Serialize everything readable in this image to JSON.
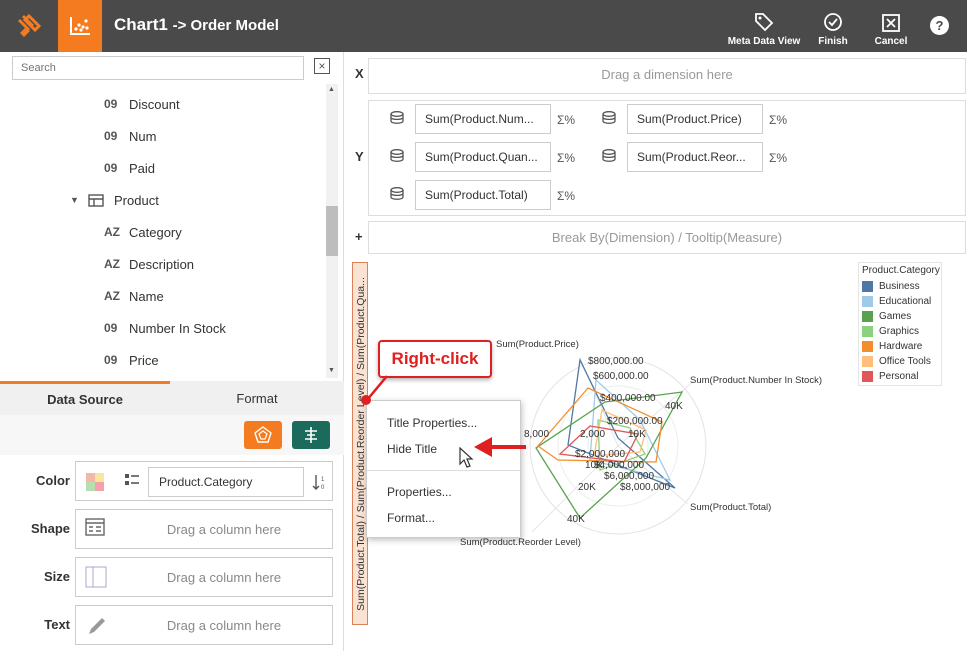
{
  "header": {
    "chart_name": "Chart1",
    "model_name": "-> Order Model",
    "buttons": [
      {
        "label": "Meta Data View",
        "icon": "tag-icon"
      },
      {
        "label": "Finish",
        "icon": "check-circle-icon"
      },
      {
        "label": "Cancel",
        "icon": "close-box-icon"
      }
    ],
    "help_icon": "help-icon"
  },
  "sidebar": {
    "search_placeholder": "Search",
    "tree": [
      {
        "type": "09",
        "label": "Discount"
      },
      {
        "type": "09",
        "label": "Num"
      },
      {
        "type": "09",
        "label": "Paid"
      },
      {
        "type": "table",
        "label": "Product"
      },
      {
        "type": "AZ",
        "label": "Category"
      },
      {
        "type": "AZ",
        "label": "Description"
      },
      {
        "type": "AZ",
        "label": "Name"
      },
      {
        "type": "09",
        "label": "Number In Stock"
      },
      {
        "type": "09",
        "label": "Price"
      }
    ],
    "tabs": [
      "Data Source",
      "Format"
    ],
    "properties": {
      "color_label": "Color",
      "color_value": "Product.Category",
      "shape_label": "Shape",
      "shape_placeholder": "Drag a column here",
      "size_label": "Size",
      "size_placeholder": "Drag a column here",
      "text_label": "Text",
      "text_placeholder": "Drag a column here"
    },
    "colors": {
      "accent": "#f47b20",
      "teal": "#1a6b5c"
    }
  },
  "shelves": {
    "x_label": "X",
    "x_placeholder": "Drag a dimension here",
    "y_label": "Y",
    "y_measures": [
      "Sum(Product.Num...",
      "Sum(Product.Price)",
      "Sum(Product.Quan...",
      "Sum(Product.Reor...",
      "Sum(Product.Total)"
    ],
    "sigma": "Σ%",
    "plus_label": "+",
    "break_placeholder": "Break By(Dimension) / Tooltip(Measure)"
  },
  "chart": {
    "vertical_title": "Sum(Product.Total) / Sum(Product.Reorder Level) / Sum(Product.Qua...",
    "axis_labels": [
      "Sum(Product.Price)",
      "Sum(Product.Number In Stock)",
      "Sum(Product.Total)",
      "Sum(Product.Reorder Level)"
    ],
    "tick_labels": [
      "$800,000.00",
      "$600,000.00",
      "$400,000.00",
      "$200,000.00",
      "40K",
      "10K",
      "2,000",
      "8,000",
      "$2,000,000",
      "$6,000,000",
      "$8,000,000",
      "20K",
      "40K",
      "$4,000,000",
      "10K"
    ],
    "legend_title": "Product.Category",
    "legend": [
      {
        "label": "Business",
        "color": "#4e79a7"
      },
      {
        "label": "Educational",
        "color": "#a0cbe8"
      },
      {
        "label": "Games",
        "color": "#59a14f"
      },
      {
        "label": "Graphics",
        "color": "#8cd17d"
      },
      {
        "label": "Hardware",
        "color": "#f28e2b"
      },
      {
        "label": "Office Tools",
        "color": "#ffbe7d"
      },
      {
        "label": "Personal",
        "color": "#e15759"
      }
    ]
  },
  "context_menu": {
    "items": [
      "Title Properties...",
      "Hide Title",
      "Properties...",
      "Format..."
    ]
  },
  "callout": {
    "label": "Right-click"
  }
}
